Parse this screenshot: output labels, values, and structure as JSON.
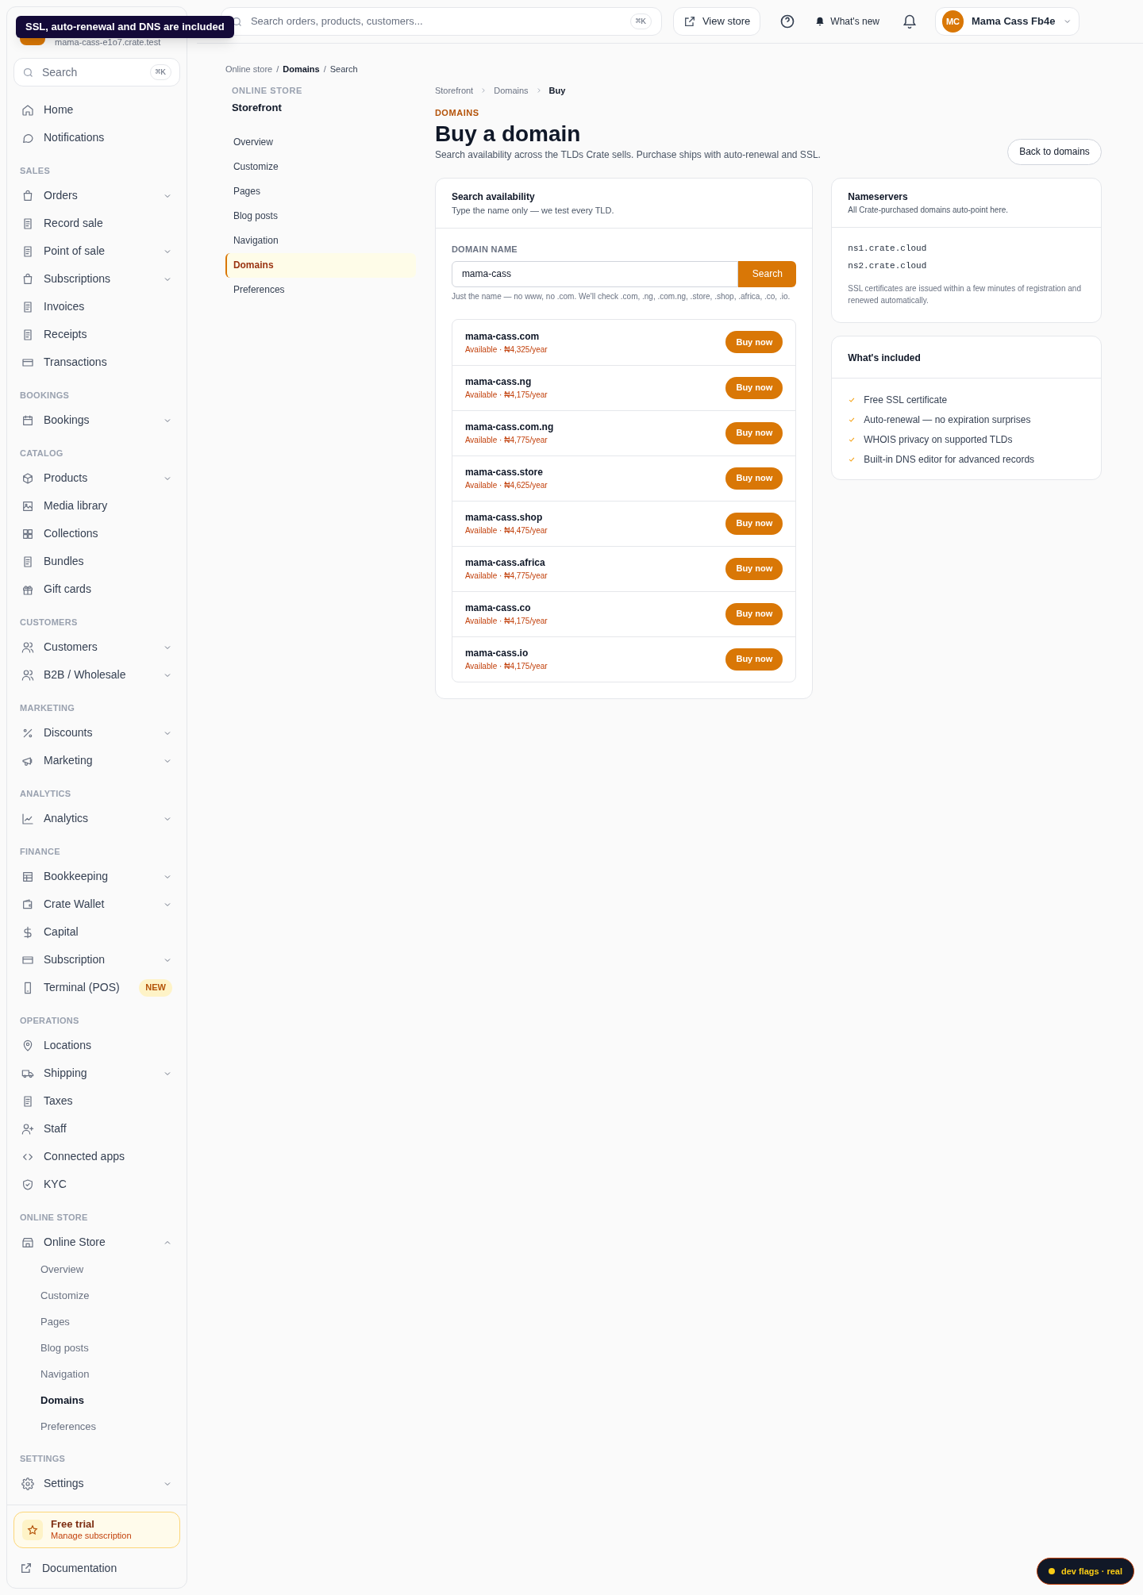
{
  "tooltip": {
    "text": "SSL, auto-renewal and DNS are included"
  },
  "sidebar": {
    "store_subdomain": "mama-cass-e1o7.crate.test",
    "search": {
      "placeholder": "Search",
      "shortcut": "⌘K"
    },
    "items": [
      {
        "kind": "link",
        "label": "Home"
      },
      {
        "kind": "link",
        "label": "Notifications"
      },
      {
        "kind": "section",
        "label": "SALES"
      },
      {
        "kind": "group",
        "label": "Orders",
        "expanded": false
      },
      {
        "kind": "link",
        "label": "Record sale"
      },
      {
        "kind": "group",
        "label": "Point of sale",
        "expanded": false
      },
      {
        "kind": "group",
        "label": "Subscriptions",
        "expanded": false
      },
      {
        "kind": "link",
        "label": "Invoices"
      },
      {
        "kind": "link",
        "label": "Receipts"
      },
      {
        "kind": "link",
        "label": "Transactions"
      },
      {
        "kind": "section",
        "label": "BOOKINGS"
      },
      {
        "kind": "group",
        "label": "Bookings",
        "expanded": false
      },
      {
        "kind": "section",
        "label": "CATALOG"
      },
      {
        "kind": "group",
        "label": "Products",
        "expanded": false
      },
      {
        "kind": "link",
        "label": "Media library"
      },
      {
        "kind": "link",
        "label": "Collections"
      },
      {
        "kind": "link",
        "label": "Bundles"
      },
      {
        "kind": "link",
        "label": "Gift cards"
      },
      {
        "kind": "section",
        "label": "CUSTOMERS"
      },
      {
        "kind": "group",
        "label": "Customers",
        "expanded": false
      },
      {
        "kind": "group",
        "label": "B2B / Wholesale",
        "expanded": false
      },
      {
        "kind": "section",
        "label": "MARKETING"
      },
      {
        "kind": "group",
        "label": "Discounts",
        "expanded": false
      },
      {
        "kind": "group",
        "label": "Marketing",
        "expanded": false
      },
      {
        "kind": "section",
        "label": "ANALYTICS"
      },
      {
        "kind": "group",
        "label": "Analytics",
        "expanded": false
      },
      {
        "kind": "section",
        "label": "FINANCE"
      },
      {
        "kind": "group",
        "label": "Bookkeeping",
        "expanded": false
      },
      {
        "kind": "group",
        "label": "Crate Wallet",
        "expanded": false
      },
      {
        "kind": "link",
        "label": "Capital"
      },
      {
        "kind": "group",
        "label": "Subscription",
        "expanded": false
      },
      {
        "kind": "link",
        "label": "Terminal (POS)",
        "badge": "NEW"
      },
      {
        "kind": "section",
        "label": "OPERATIONS"
      },
      {
        "kind": "link",
        "label": "Locations"
      },
      {
        "kind": "group",
        "label": "Shipping",
        "expanded": false
      },
      {
        "kind": "link",
        "label": "Taxes"
      },
      {
        "kind": "link",
        "label": "Staff"
      },
      {
        "kind": "link",
        "label": "Connected apps"
      },
      {
        "kind": "link",
        "label": "KYC"
      },
      {
        "kind": "section",
        "label": "ONLINE STORE"
      },
      {
        "kind": "group",
        "label": "Online Store",
        "expanded": true,
        "children": [
          {
            "label": "Overview",
            "selected": false
          },
          {
            "label": "Customize",
            "selected": false
          },
          {
            "label": "Pages",
            "selected": false
          },
          {
            "label": "Blog posts",
            "selected": false
          },
          {
            "label": "Navigation",
            "selected": false
          },
          {
            "label": "Domains",
            "selected": true
          },
          {
            "label": "Preferences",
            "selected": false
          }
        ]
      },
      {
        "kind": "section",
        "label": "SETTINGS"
      },
      {
        "kind": "group",
        "label": "Settings",
        "expanded": false
      }
    ],
    "trial": {
      "title": "Free trial",
      "subtitle": "Manage subscription"
    },
    "documentation": "Documentation"
  },
  "topbar": {
    "search": {
      "placeholder": "Search orders, products, customers...",
      "shortcut": "⌘K"
    },
    "view_store": "View store",
    "whats_new": "What's new",
    "account": {
      "initials": "MC",
      "name": "Mama Cass Fb4e"
    }
  },
  "breadcrumb": [
    {
      "label": "Online store",
      "emphasized": false
    },
    {
      "separator": "/",
      "label": "Domains",
      "emphasized": true
    },
    {
      "separator": "/",
      "label": "Search",
      "emphasized": false
    }
  ],
  "store_nav": {
    "heading": "ONLINE STORE",
    "title": "Storefront",
    "items": [
      {
        "label": "Overview",
        "selected": false
      },
      {
        "label": "Customize",
        "selected": false
      },
      {
        "label": "Pages",
        "selected": false
      },
      {
        "label": "Blog posts",
        "selected": false
      },
      {
        "label": "Navigation",
        "selected": false
      },
      {
        "label": "Domains",
        "selected": true
      },
      {
        "label": "Preferences",
        "selected": false
      }
    ]
  },
  "page": {
    "breadcrumb": [
      "Storefront",
      "Domains",
      "Buy"
    ],
    "eyebrow": "DOMAINS",
    "title": "Buy a domain",
    "subtitle": "Search availability across the TLDs Crate sells. Purchase ships with auto-renewal and SSL.",
    "back_button": "Back to domains"
  },
  "search_card": {
    "title": "Search availability",
    "subtitle": "Type the name only — we test every TLD.",
    "field_label": "DOMAIN NAME",
    "value": "mama-cass",
    "button": "Search",
    "hint": "Just the name — no www, no .com. We'll check .com, .ng, .com.ng, .store, .shop, .africa, .co, .io.",
    "results": [
      {
        "domain": "mama-cass.com",
        "status": "Available · ₦4,325/year",
        "action": "Buy now"
      },
      {
        "domain": "mama-cass.ng",
        "status": "Available · ₦4,175/year",
        "action": "Buy now"
      },
      {
        "domain": "mama-cass.com.ng",
        "status": "Available · ₦4,775/year",
        "action": "Buy now"
      },
      {
        "domain": "mama-cass.store",
        "status": "Available · ₦4,625/year",
        "action": "Buy now"
      },
      {
        "domain": "mama-cass.shop",
        "status": "Available · ₦4,475/year",
        "action": "Buy now"
      },
      {
        "domain": "mama-cass.africa",
        "status": "Available · ₦4,775/year",
        "action": "Buy now"
      },
      {
        "domain": "mama-cass.co",
        "status": "Available · ₦4,175/year",
        "action": "Buy now"
      },
      {
        "domain": "mama-cass.io",
        "status": "Available · ₦4,175/year",
        "action": "Buy now"
      }
    ]
  },
  "nameservers_card": {
    "title": "Nameservers",
    "subtitle": "All Crate-purchased domains auto-point here.",
    "servers": [
      "ns1.crate.cloud",
      "ns2.crate.cloud"
    ],
    "note": "SSL certificates are issued within a few minutes of registration and renewed automatically."
  },
  "included_card": {
    "title": "What's included",
    "items": [
      "Free SSL certificate",
      "Auto-renewal — no expiration surprises",
      "WHOIS privacy on supported TLDs",
      "Built-in DNS editor for advanced records"
    ]
  },
  "dev_flags": "dev flags · real"
}
